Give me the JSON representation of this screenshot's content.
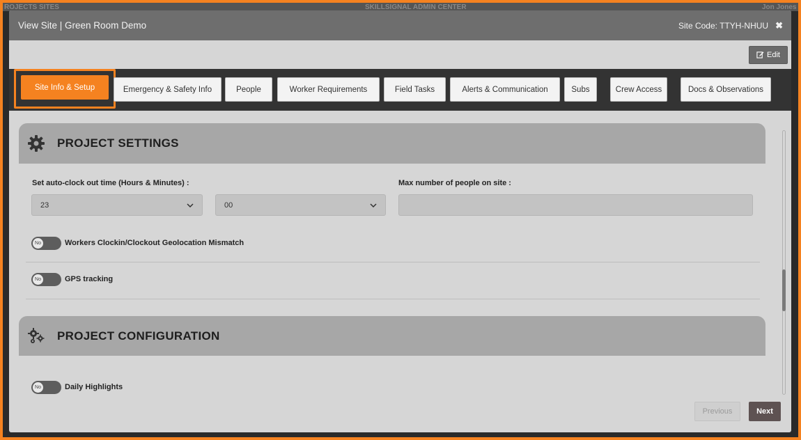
{
  "background_header": {
    "left": "ROJECTS SITES",
    "center": "SKILLSIGNAL ADMIN CENTER",
    "right": "Jon Jones"
  },
  "modal": {
    "title": "View Site | Green Room Demo",
    "site_code": "Site Code: TTYH-NHUU",
    "edit_label": "Edit"
  },
  "tabs": [
    {
      "label": "Site Info & Setup",
      "active": true
    },
    {
      "label": "Emergency & Safety Info"
    },
    {
      "label": "People"
    },
    {
      "label": "Worker Requirements"
    },
    {
      "label": "Field Tasks"
    },
    {
      "label": "Alerts & Communication"
    },
    {
      "label": "Subs"
    },
    {
      "label": "Crew Access"
    },
    {
      "label": "Docs & Observations"
    }
  ],
  "project_settings": {
    "heading": "PROJECT SETTINGS",
    "autoclock_label": "Set auto-clock out time (Hours & Minutes) :",
    "hours_value": "23",
    "minutes_value": "00",
    "max_people_label": "Max number of people on site :",
    "max_people_value": "",
    "geo_toggle": {
      "label": "Workers Clockin/Clockout Geolocation Mismatch",
      "state": "No"
    },
    "gps_toggle": {
      "label": "GPS tracking",
      "state": "No"
    }
  },
  "project_configuration": {
    "heading": "PROJECT CONFIGURATION",
    "daily_toggle": {
      "label": "Daily Highlights",
      "state": "No"
    }
  },
  "footer": {
    "previous_label": "Previous",
    "next_label": "Next"
  },
  "colors": {
    "accent": "#f58220",
    "titlebar": "#6e6e6e",
    "tabbar": "#333333",
    "next_button": "#5e5252"
  }
}
